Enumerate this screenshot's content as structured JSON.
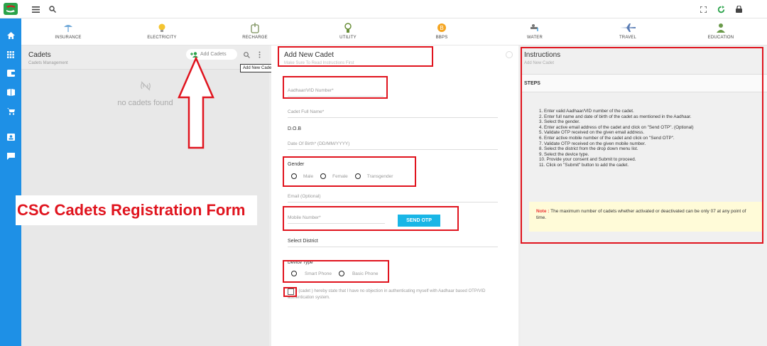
{
  "topbar": {
    "menu_icon": "menu-icon",
    "search_icon": "search-icon",
    "fullscreen_icon": "fullscreen-icon",
    "refresh_icon": "refresh-icon",
    "lock_icon": "lock-icon"
  },
  "categories": [
    {
      "label": "INSURANCE",
      "icon": "insurance-icon"
    },
    {
      "label": "ELECTRICITY",
      "icon": "bulb-icon"
    },
    {
      "label": "RECHARGE",
      "icon": "recharge-icon"
    },
    {
      "label": "UTILITY",
      "icon": "utility-icon"
    },
    {
      "label": "BBPS",
      "icon": "bbps-icon"
    },
    {
      "label": "WATER",
      "icon": "water-icon"
    },
    {
      "label": "TRAVEL",
      "icon": "plane-icon"
    },
    {
      "label": "EDUCATION",
      "icon": "education-icon"
    }
  ],
  "cadets_panel": {
    "title": "Cadets",
    "subtitle": "Cadets Management",
    "add_button": "Add Cadets",
    "tooltip": "Add New Cadet",
    "empty_text": "no cadets found"
  },
  "form": {
    "title": "Add New Cadet",
    "subtitle": "Make Sure To Read Instructions First",
    "aadhaar_placeholder": "Aadhaar/VID Number*",
    "name_placeholder": "Cadet Full Name*",
    "dob_label": "D.O.B",
    "dob_placeholder": "Date Of Birth* (DD/MM/YYYY)",
    "gender_label": "Gender",
    "gender_options": [
      "Male",
      "Female",
      "Transgender"
    ],
    "email_placeholder": "Email (Optional)",
    "mobile_placeholder": "Mobile Number*",
    "send_otp": "SEND OTP",
    "district_label": "Select District",
    "device_label": "Device Type",
    "device_options": [
      "Smart Phone",
      "Basic Phone"
    ],
    "consent_text": "I (cadet ) hereby state that I have no objection in authenticating myself with Aadhaar based OTP/VID authentication system."
  },
  "instructions": {
    "title": "Instructions",
    "subtitle": "Add New Cadet",
    "steps_heading": "STEPS",
    "steps": [
      "1. Enter valid Aadhaar/VID number of the cadet.",
      "2. Enter full name and date of birth of the cadet as mentioned in the Aadhaar.",
      "3. Select the gender.",
      "4. Enter active email address of the cadet and click on \"Send OTP\". (Optional)",
      "5. Validate OTP received on the given email address.",
      "6. Enter active mobile number of the cadet and click on \"Send OTP\".",
      "7. Validate OTP received on the given mobile number.",
      "8. Select the district from the drop down menu list.",
      "9. Select the device type.",
      "10. Provide your consent and Submit to proceed.",
      "11. Click on \"Submit\" button to add the cadet."
    ],
    "note_label": "Note :",
    "note_text": "The maximum number of cadets whether activated or deactivated can be only 07 at any point of time."
  },
  "overlay": {
    "big_label": "CSC Cadets Registration Form"
  },
  "colors": {
    "accent_blue": "#1e90e6",
    "otp_button": "#19b6e6",
    "highlight_red": "#e0141e",
    "note_bg": "#fffbd8"
  }
}
